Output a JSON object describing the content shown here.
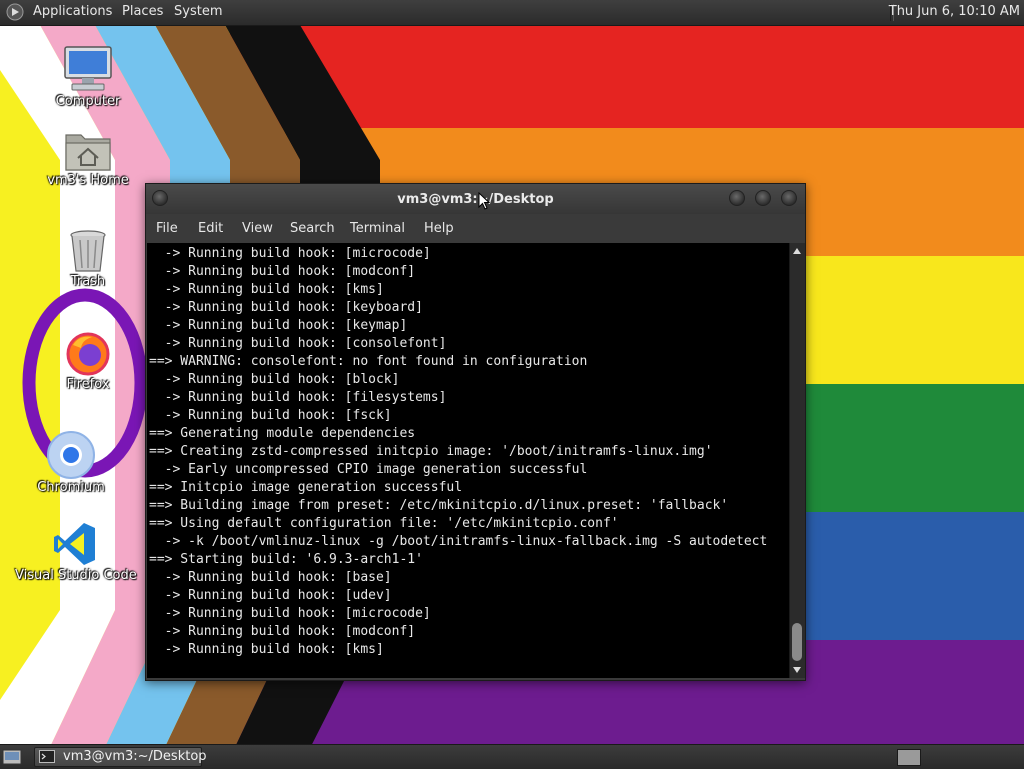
{
  "top_panel": {
    "menus": [
      "Applications",
      "Places",
      "System"
    ],
    "clock": "Thu Jun  6, 10:10 AM"
  },
  "desktop": {
    "icons": [
      {
        "label": "Computer",
        "icon": "computer-icon"
      },
      {
        "label": "vm3's Home",
        "icon": "home-folder-icon"
      },
      {
        "label": "Trash",
        "icon": "trash-icon"
      },
      {
        "label": "Firefox",
        "icon": "firefox-icon"
      },
      {
        "label": "Chromium",
        "icon": "chromium-icon"
      },
      {
        "label": "Visual Studio Code",
        "icon": "vscode-icon"
      }
    ],
    "wallpaper": "progress-pride-flag"
  },
  "terminal": {
    "title": "vm3@vm3:~/Desktop",
    "menu": [
      "File",
      "Edit",
      "View",
      "Search",
      "Terminal",
      "Help"
    ],
    "lines": [
      "  -> Running build hook: [microcode]",
      "  -> Running build hook: [modconf]",
      "  -> Running build hook: [kms]",
      "  -> Running build hook: [keyboard]",
      "  -> Running build hook: [keymap]",
      "  -> Running build hook: [consolefont]",
      "==> WARNING: consolefont: no font found in configuration",
      "  -> Running build hook: [block]",
      "  -> Running build hook: [filesystems]",
      "  -> Running build hook: [fsck]",
      "==> Generating module dependencies",
      "==> Creating zstd-compressed initcpio image: '/boot/initramfs-linux.img'",
      "  -> Early uncompressed CPIO image generation successful",
      "==> Initcpio image generation successful",
      "==> Building image from preset: /etc/mkinitcpio.d/linux.preset: 'fallback'",
      "==> Using default configuration file: '/etc/mkinitcpio.conf'",
      "  -> -k /boot/vmlinuz-linux -g /boot/initramfs-linux-fallback.img -S autodetect",
      "==> Starting build: '6.9.3-arch1-1'",
      "  -> Running build hook: [base]",
      "  -> Running build hook: [udev]",
      "  -> Running build hook: [microcode]",
      "  -> Running build hook: [modconf]",
      "  -> Running build hook: [kms]"
    ]
  },
  "taskbar": {
    "window_button": "vm3@vm3:~/Desktop"
  },
  "colors": {
    "panel": "#2f2f2f",
    "terminal_bg": "#000000",
    "terminal_fg": "#e8e8e8"
  }
}
